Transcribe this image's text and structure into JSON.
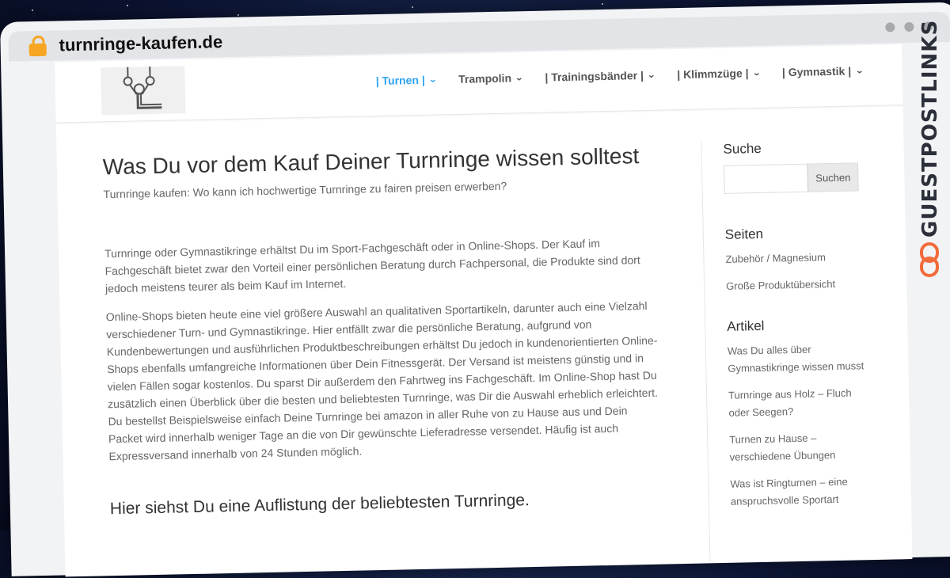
{
  "browser": {
    "url": "turnringe-kaufen.de"
  },
  "nav": {
    "items": [
      {
        "label": "| Turnen |",
        "active": true
      },
      {
        "label": "Trampolin",
        "active": false
      },
      {
        "label": "| Trainingsbänder |",
        "active": false
      },
      {
        "label": "| Klimmzüge |",
        "active": false
      },
      {
        "label": "| Gymnastik |",
        "active": false
      }
    ]
  },
  "article": {
    "title": "Was Du vor dem Kauf Deiner Turnringe wissen solltest",
    "subtitle": "Turnringe kaufen: Wo kann ich hochwertige Turnringe zu fairen preisen erwerben?",
    "paragraphs": [
      "Turnringe oder Gymnastikringe erhältst Du im Sport-Fachgeschäft oder in Online-Shops. Der Kauf im Fachgeschäft bietet zwar den Vorteil einer persönlichen Beratung durch Fachpersonal, die Produkte sind dort jedoch meistens teurer als beim Kauf im Internet.",
      "Online-Shops bieten heute eine viel größere Auswahl an qualitativen Sportartikeln, darunter auch eine Vielzahl verschiedener Turn- und Gymnastikringe. Hier entfällt zwar die persönliche Beratung, aufgrund von Kundenbewertungen und ausführlichen Produktbeschreibungen erhältst Du jedoch in kundenorientierten Online-Shops ebenfalls umfangreiche Informationen über Dein Fitnessgerät. Der Versand ist meistens günstig und in vielen Fällen sogar kostenlos. Du sparst Dir außerdem den Fahrtweg ins Fachgeschäft. Im Online-Shop hast Du zusätzlich einen Überblick über die besten und beliebtesten Turnringe, was Dir die Auswahl erheblich erleichtert. Du bestellst Beispielsweise einfach Deine Turnringe bei amazon in aller Ruhe von zu Hause aus und Dein Packet wird innerhalb weniger Tage an die von Dir gewünschte Lieferadresse versendet. Häufig ist auch Expressversand innerhalb von 24 Stunden möglich."
    ],
    "section_heading": "Hier siehst Du eine Auflistung der beliebtesten Turnringe."
  },
  "sidebar": {
    "search_title": "Suche",
    "search_button": "Suchen",
    "pages_title": "Seiten",
    "pages": [
      "Zubehör / Magnesium",
      "Große Produktübersicht"
    ],
    "articles_title": "Artikel",
    "articles": [
      "Was Du alles über Gymnastikringe wissen musst",
      "Turnringe aus Holz – Fluch oder Seegen?",
      "Turnen zu Hause – verschiedene Übungen",
      "Was ist Ringturnen – eine anspruchsvolle Sportart"
    ]
  },
  "brand": {
    "name": "GUESTPOSTLINKS"
  },
  "colors": {
    "accent": "#2ea3f2",
    "lock": "#f6a623",
    "brand_icon": "#f26b3a"
  }
}
